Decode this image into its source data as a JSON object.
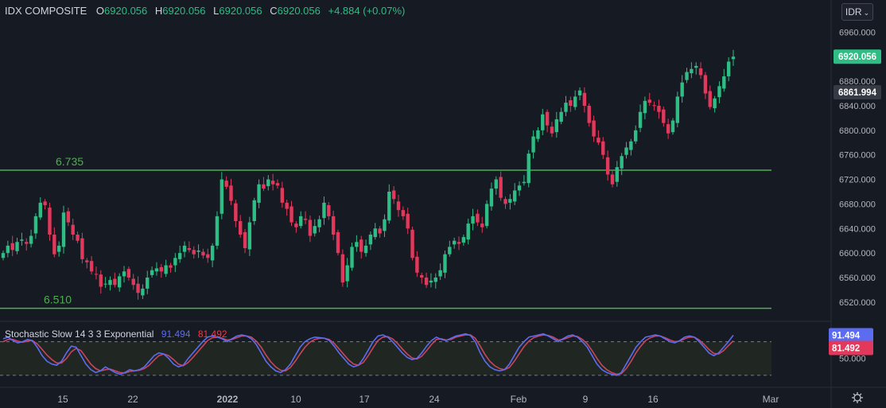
{
  "header": {
    "symbol": "IDX COMPOSITE",
    "open_label": "O",
    "open": "6920.056",
    "high_label": "H",
    "high": "6920.056",
    "low_label": "L",
    "low": "6920.056",
    "close_label": "C",
    "close": "6920.056",
    "change": "+4.884 (+0.07%)"
  },
  "currency": "IDR",
  "stochastic": {
    "name": "Stochastic Slow 14 3 3 Exponential",
    "k_value": "91.494",
    "d_value": "81.492"
  },
  "colors": {
    "background": "#161a22",
    "up": "#2ebd85",
    "down": "#e2385b",
    "level_line": "#4caf50",
    "stoch_k": "#5b6cf0",
    "stoch_d": "#c8455e",
    "stoch_band": "#2a3324"
  },
  "chart_data": [
    {
      "type": "candlestick",
      "title": "IDX COMPOSITE",
      "ylim": [
        6490,
        6980
      ],
      "y_ticks": [
        "6960.000",
        "6920.000",
        "6880.000",
        "6840.000",
        "6800.000",
        "6760.000",
        "6720.000",
        "6680.000",
        "6640.000",
        "6600.000",
        "6560.000",
        "6520.000"
      ],
      "x_ticks": [
        "15",
        "22",
        "2022",
        "10",
        "17",
        "24",
        "Feb",
        "9",
        "16",
        "Mar"
      ],
      "price_labels": [
        {
          "value": 6920.056,
          "text": "6920.056",
          "kind": "last"
        },
        {
          "value": 6861.994,
          "text": "6861.994",
          "kind": "crosshair"
        }
      ],
      "levels": [
        {
          "value": 6735,
          "label": "6.735"
        },
        {
          "value": 6510,
          "label": "6.510"
        }
      ],
      "closes": [
        6600,
        6612,
        6605,
        6618,
        6622,
        6615,
        6628,
        6660,
        6682,
        6678,
        6630,
        6598,
        6612,
        6666,
        6650,
        6630,
        6620,
        6590,
        6585,
        6570,
        6565,
        6545,
        6550,
        6556,
        6548,
        6562,
        6570,
        6560,
        6548,
        6535,
        6542,
        6560,
        6572,
        6575,
        6570,
        6580,
        6576,
        6592,
        6600,
        6612,
        6605,
        6598,
        6604,
        6596,
        6592,
        6612,
        6660,
        6720,
        6708,
        6685,
        6652,
        6630,
        6608,
        6650,
        6686,
        6712,
        6705,
        6720,
        6712,
        6710,
        6682,
        6672,
        6650,
        6642,
        6660,
        6654,
        6628,
        6644,
        6655,
        6682,
        6660,
        6630,
        6600,
        6552,
        6580,
        6610,
        6618,
        6602,
        6612,
        6630,
        6640,
        6632,
        6655,
        6700,
        6688,
        6670,
        6660,
        6640,
        6592,
        6568,
        6560,
        6548,
        6555,
        6560,
        6572,
        6598,
        6610,
        6620,
        6615,
        6626,
        6648,
        6660,
        6650,
        6642,
        6680,
        6705,
        6720,
        6690,
        6680,
        6688,
        6702,
        6710,
        6716,
        6762,
        6790,
        6800,
        6826,
        6808,
        6795,
        6818,
        6830,
        6845,
        6840,
        6855,
        6865,
        6840,
        6812,
        6790,
        6780,
        6760,
        6728,
        6712,
        6740,
        6758,
        6772,
        6782,
        6800,
        6830,
        6848,
        6845,
        6840,
        6830,
        6812,
        6795,
        6816,
        6855,
        6878,
        6895,
        6900,
        6905,
        6890,
        6860,
        6838,
        6852,
        6872,
        6888,
        6912,
        6920.056
      ],
      "stochastic_k": [
        85,
        88,
        82,
        78,
        80,
        84,
        82,
        70,
        55,
        45,
        40,
        38,
        45,
        60,
        72,
        70,
        55,
        40,
        30,
        25,
        28,
        35,
        30,
        25,
        22,
        25,
        30,
        28,
        30,
        35,
        45,
        55,
        60,
        58,
        50,
        40,
        35,
        38,
        50,
        60,
        70,
        80,
        88,
        90,
        88,
        85,
        80,
        85,
        90,
        92,
        90,
        85,
        75,
        60,
        45,
        35,
        28,
        25,
        30,
        40,
        55,
        70,
        80,
        85,
        88,
        87,
        86,
        82,
        72,
        60,
        50,
        40,
        35,
        38,
        50,
        65,
        80,
        90,
        92,
        88,
        80,
        70,
        60,
        52,
        48,
        50,
        60,
        72,
        82,
        88,
        84,
        82,
        86,
        90,
        92,
        94,
        91,
        80,
        60,
        45,
        35,
        30,
        28,
        30,
        40,
        55,
        70,
        80,
        88,
        90,
        92,
        94,
        90,
        85,
        80,
        85,
        90,
        92,
        88,
        80,
        70,
        55,
        40,
        30,
        25,
        22,
        20,
        25,
        40,
        55,
        70,
        80,
        88,
        90,
        92,
        90,
        85,
        80,
        78,
        82,
        88,
        90,
        88,
        80,
        70,
        60,
        55,
        60,
        70,
        80,
        91.494
      ],
      "stochastic_d": [
        80,
        84,
        84,
        81,
        79,
        81,
        82,
        76,
        66,
        56,
        48,
        42,
        42,
        50,
        62,
        68,
        64,
        52,
        40,
        32,
        28,
        30,
        31,
        28,
        25,
        24,
        27,
        28,
        29,
        32,
        38,
        47,
        55,
        58,
        55,
        48,
        40,
        37,
        43,
        52,
        62,
        72,
        82,
        87,
        88,
        86,
        83,
        84,
        87,
        90,
        90,
        88,
        81,
        70,
        56,
        44,
        35,
        29,
        28,
        34,
        45,
        58,
        70,
        79,
        84,
        86,
        86,
        84,
        77,
        67,
        57,
        47,
        40,
        38,
        43,
        55,
        69,
        82,
        88,
        89,
        85,
        77,
        67,
        58,
        51,
        49,
        54,
        64,
        75,
        84,
        85,
        83,
        84,
        88,
        90,
        92,
        92,
        86,
        72,
        57,
        45,
        37,
        32,
        30,
        34,
        45,
        58,
        71,
        81,
        87,
        90,
        92,
        91,
        88,
        83,
        84,
        87,
        90,
        89,
        84,
        76,
        64,
        50,
        38,
        30,
        25,
        22,
        23,
        32,
        45,
        60,
        72,
        82,
        87,
        90,
        90,
        87,
        83,
        80,
        81,
        85,
        88,
        88,
        83,
        75,
        66,
        59,
        58,
        64,
        73,
        81.492
      ],
      "stochastic_ylim": [
        0,
        112
      ],
      "stochastic_y_ticks": [
        "50.000"
      ],
      "stochastic_bands": [
        20,
        80
      ]
    }
  ]
}
